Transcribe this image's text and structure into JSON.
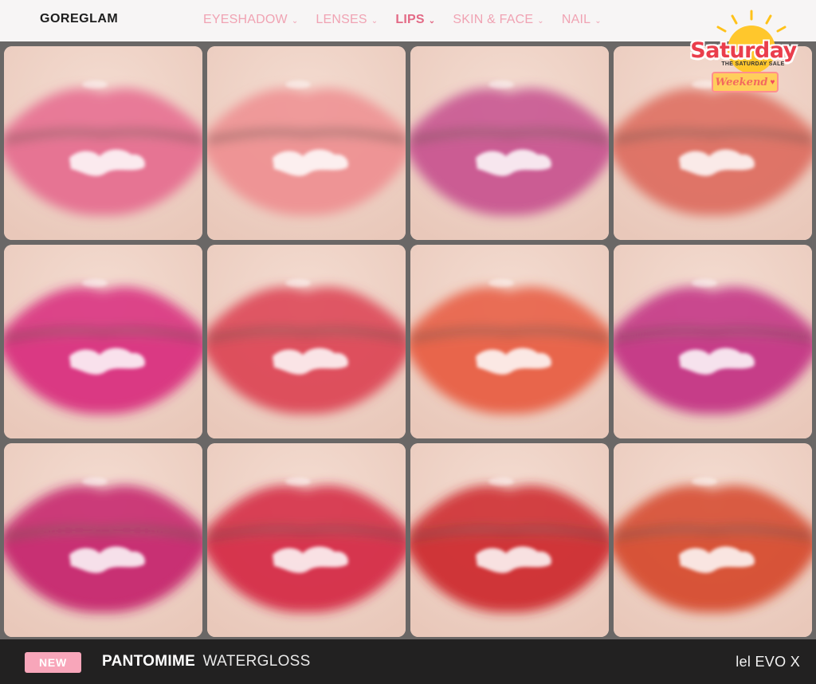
{
  "brand": "GOREGLAM",
  "nav": {
    "items": [
      {
        "label": "EYESHADOW",
        "active": false
      },
      {
        "label": "LENSES",
        "active": false
      },
      {
        "label": "LIPS",
        "active": true
      },
      {
        "label": "SKIN & FACE",
        "active": false
      },
      {
        "label": "NAIL",
        "active": false
      }
    ],
    "chevron_icon": "chevron-down-icon"
  },
  "badge": {
    "title": "Saturday",
    "subtitle": "THE SATURDAY SALE",
    "pill": "Weekend",
    "icons": [
      "sun-icon",
      "heart-icon"
    ]
  },
  "swatches": [
    {
      "color": "#e66a8e"
    },
    {
      "color": "#ee8e90"
    },
    {
      "color": "#c64f8e"
    },
    {
      "color": "#dd6a5c"
    },
    {
      "color": "#d8287c"
    },
    {
      "color": "#dc4152"
    },
    {
      "color": "#e85a3e"
    },
    {
      "color": "#c22e82"
    },
    {
      "color": "#c4206a"
    },
    {
      "color": "#d42440"
    },
    {
      "color": "#cc2428"
    },
    {
      "color": "#d5452a"
    }
  ],
  "footer": {
    "tag": "NEW",
    "product_name": "PANTOMIME",
    "product_type": "WATERGLOSS",
    "compatibility": "lel EVO X"
  }
}
